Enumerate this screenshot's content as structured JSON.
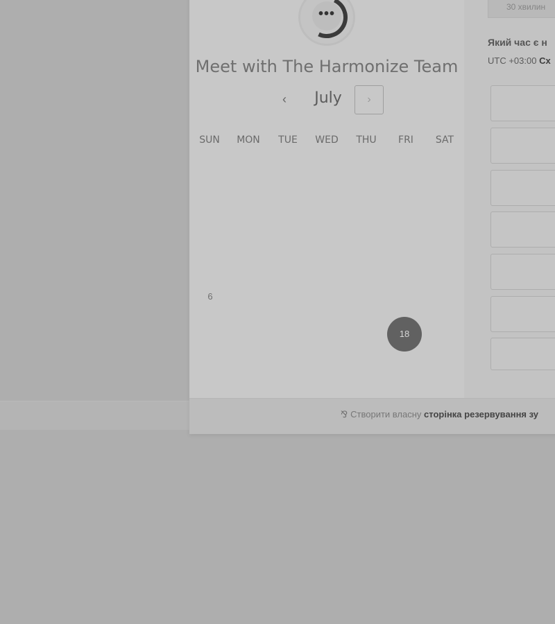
{
  "header": {
    "title": "Meet with The Harmonize Team",
    "avatar_icon": "chat-bubble-dots-icon",
    "avatar_glyph": "•••"
  },
  "calendar": {
    "month": "July",
    "prev_glyph": "‹",
    "next_glyph": "›",
    "weekdays": [
      "SUN",
      "MON",
      "TUE",
      "WED",
      "THU",
      "FRI",
      "SAT"
    ],
    "visible_days": {
      "day_6": "6",
      "day_18_selected": "18"
    }
  },
  "scheduler": {
    "duration_label": "30 хвилин",
    "timezone_question": "Який час є н",
    "timezone_prefix": "UTC +03:00",
    "timezone_name": "Сх"
  },
  "footer": {
    "icon": "hubspot-sprocket-icon",
    "icon_glyph": "⅋",
    "text_prefix": "Створити власну",
    "text_bold": "сторінка резервування зу"
  },
  "colors": {
    "overlay": "#aeaeae",
    "selected_day": "#616161",
    "accent_ring": "#3a3a3a"
  }
}
